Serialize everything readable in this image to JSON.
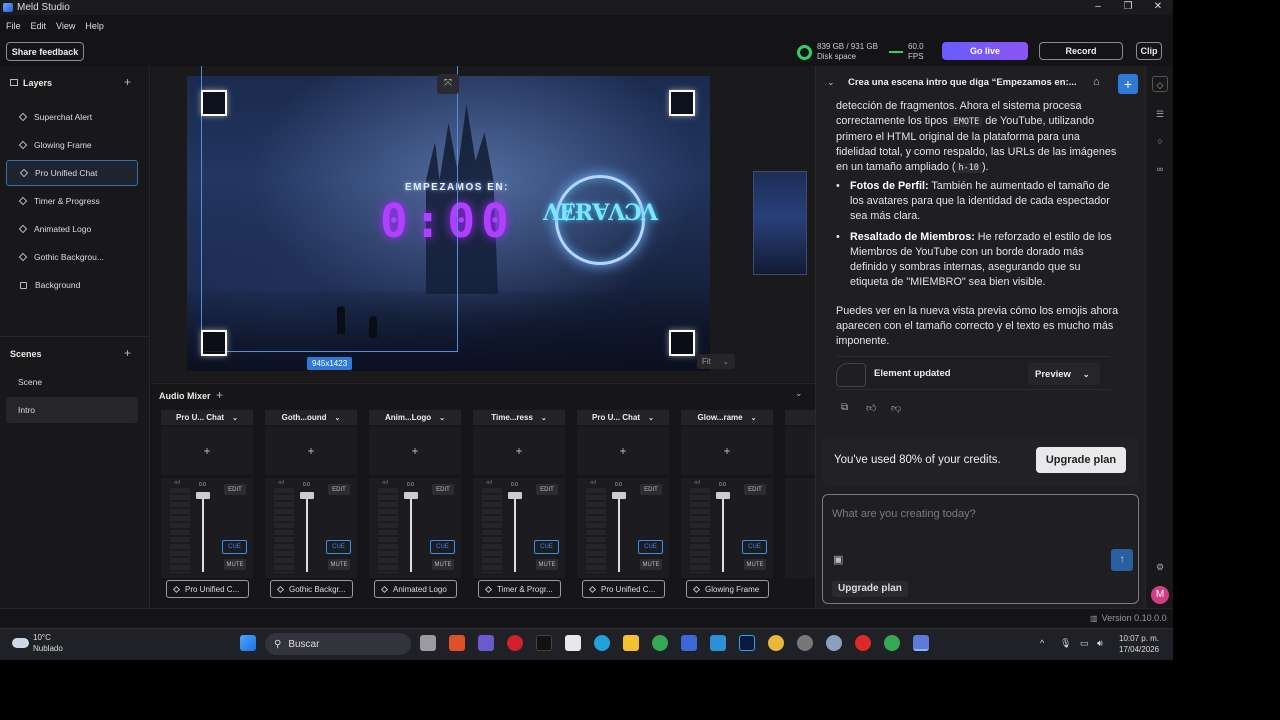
{
  "window": {
    "title": "Meld Studio",
    "controls": [
      "–",
      "❐",
      "✕"
    ]
  },
  "menu": [
    "File",
    "Edit",
    "View",
    "Help"
  ],
  "toolbar": {
    "share_feedback": "Share feedback",
    "disk_line1": "839 GB / 931 GB",
    "disk_line2": "Disk space",
    "fps_value": "60.0",
    "fps_label": "FPS",
    "go_live": "Go live",
    "record": "Record",
    "clip": "Clip"
  },
  "layers": {
    "title": "Layers",
    "items": [
      {
        "label": "Superchat Alert",
        "icon": "diamond-icon"
      },
      {
        "label": "Glowing Frame",
        "icon": "diamond-icon"
      },
      {
        "label": "Pro Unified Chat",
        "icon": "diamond-icon",
        "selected": true
      },
      {
        "label": "Timer & Progress",
        "icon": "diamond-icon"
      },
      {
        "label": "Animated Logo",
        "icon": "diamond-icon"
      },
      {
        "label": "Gothic Backgrou...",
        "icon": "diamond-icon"
      },
      {
        "label": "Background",
        "icon": "square-icon"
      }
    ]
  },
  "scenes": {
    "title": "Scenes",
    "items": [
      {
        "label": "Scene"
      },
      {
        "label": "Intro",
        "selected": true
      }
    ]
  },
  "canvas": {
    "intro_text": "EMPEZAMOS EN:",
    "timer": "0:00",
    "dimensions": "945x1423",
    "fit": "Fit"
  },
  "mixer": {
    "title": "Audio Mixer",
    "meter_label": "-inf",
    "level": "0.0",
    "edit": "EDIT",
    "cue": "CUE",
    "mute": "MUTE",
    "channels": [
      {
        "header": "Pro U... Chat",
        "footer": "Pro Unified C..."
      },
      {
        "header": "Goth...ound",
        "footer": "Gothic Backgr..."
      },
      {
        "header": "Anim...Logo",
        "footer": "Animated Logo"
      },
      {
        "header": "Time...ress",
        "footer": "Timer & Progr..."
      },
      {
        "header": "Pro U... Chat",
        "footer": "Pro Unified C..."
      },
      {
        "header": "Glow...rame",
        "footer": "Glowing Frame"
      }
    ]
  },
  "chat": {
    "title": "Crea una escena intro que diga “Empezamos en:...",
    "p1_a": "detección de fragmentos. Ahora el sistema procesa correctamente los tipos ",
    "p1_code": "EMOTE",
    "p1_b": " de YouTube, utilizando primero el HTML original de la plataforma para una fidelidad total, y como respaldo, las URLs de las imágenes en un tamaño ampliado (",
    "p1_code2": "h-10",
    "p1_c": ").",
    "b1_title": "Fotos de Perfil:",
    "b1_text": " También he aumentado el tamaño de los avatares para que la identidad de cada espectador sea más clara.",
    "b2_title": "Resaltado de Miembros:",
    "b2_text": " He reforzado el estilo de los Miembros de YouTube con un borde dorado más definido y sombras internas, asegurando que su etiqueta de \"MIEMBRO\" sea bien visible.",
    "p2": "Puedes ver en la nueva vista previa cómo los emojis ahora aparecen con el tamaño correcto y el texto es mucho más imponente.",
    "element_updated": "Element updated",
    "preview": "Preview",
    "credits_text": "You've used 80% of your credits.",
    "upgrade_plan": "Upgrade plan",
    "composer_placeholder": "What are you creating today?",
    "upgrade_chip": "Upgrade plan",
    "avatar_letter": "M"
  },
  "status": {
    "version": "Version 0.10.0.0"
  },
  "taskbar": {
    "temp": "10°C",
    "weather": "Nublado",
    "search": "Buscar",
    "time": "10:07 p. m.",
    "date": "17/04/2026"
  },
  "colors": {
    "accent": "#2f7ad8",
    "go_live": "#7b58f5",
    "timer": "#b03fff",
    "disk_ok": "#2ad46a"
  }
}
